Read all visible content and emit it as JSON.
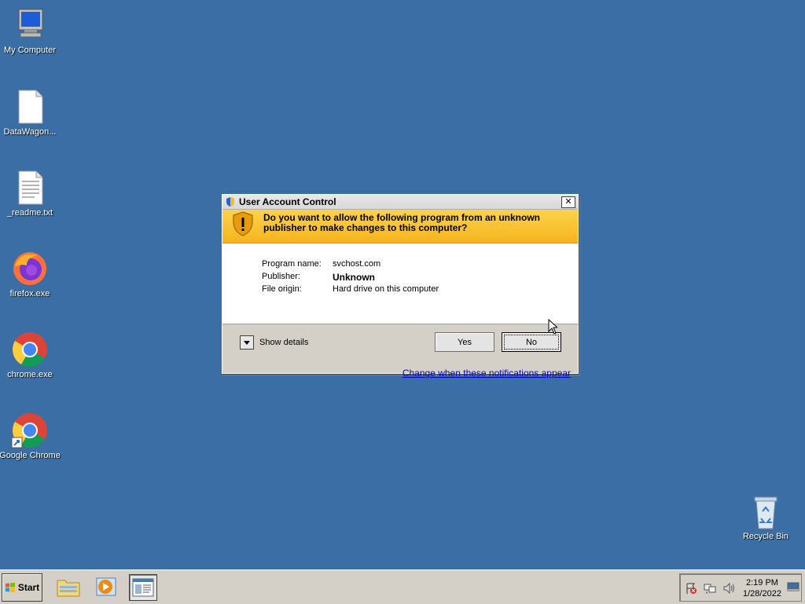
{
  "desktop": {
    "icons": [
      {
        "label": "My Computer"
      },
      {
        "label": "DataWagon..."
      },
      {
        "label": "_readme.txt"
      },
      {
        "label": "firefox.exe"
      },
      {
        "label": "chrome.exe"
      },
      {
        "label": "Google Chrome"
      },
      {
        "label": "Recycle Bin"
      }
    ]
  },
  "dialog": {
    "title": "User Account Control",
    "question": "Do you want to allow the following program from an unknown publisher to make changes to this computer?",
    "fields": [
      {
        "key": "Program name:",
        "value": "svchost.com"
      },
      {
        "key": "Publisher:",
        "value": "Unknown"
      },
      {
        "key": "File origin:",
        "value": "Hard drive on this computer"
      }
    ],
    "show_details_label": "Show details",
    "yes_label": "Yes",
    "no_label": "No",
    "link_label": "Change when these notifications appear"
  },
  "taskbar": {
    "start_label": "Start",
    "clock_time": "2:19 PM",
    "clock_date": "1/28/2022"
  },
  "colors": {
    "desktop": "#3a6ea5",
    "banner": "#f5b41d",
    "link": "#0000cc"
  }
}
